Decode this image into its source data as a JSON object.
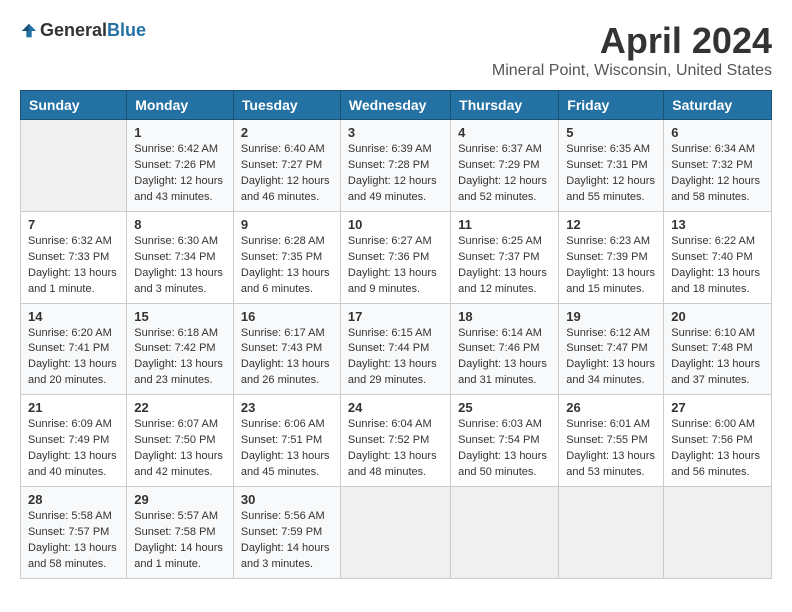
{
  "logo": {
    "general": "General",
    "blue": "Blue"
  },
  "title": "April 2024",
  "location": "Mineral Point, Wisconsin, United States",
  "days": [
    "Sunday",
    "Monday",
    "Tuesday",
    "Wednesday",
    "Thursday",
    "Friday",
    "Saturday"
  ],
  "weeks": [
    [
      {
        "day": "",
        "content": ""
      },
      {
        "day": "1",
        "content": "Sunrise: 6:42 AM\nSunset: 7:26 PM\nDaylight: 12 hours\nand 43 minutes."
      },
      {
        "day": "2",
        "content": "Sunrise: 6:40 AM\nSunset: 7:27 PM\nDaylight: 12 hours\nand 46 minutes."
      },
      {
        "day": "3",
        "content": "Sunrise: 6:39 AM\nSunset: 7:28 PM\nDaylight: 12 hours\nand 49 minutes."
      },
      {
        "day": "4",
        "content": "Sunrise: 6:37 AM\nSunset: 7:29 PM\nDaylight: 12 hours\nand 52 minutes."
      },
      {
        "day": "5",
        "content": "Sunrise: 6:35 AM\nSunset: 7:31 PM\nDaylight: 12 hours\nand 55 minutes."
      },
      {
        "day": "6",
        "content": "Sunrise: 6:34 AM\nSunset: 7:32 PM\nDaylight: 12 hours\nand 58 minutes."
      }
    ],
    [
      {
        "day": "7",
        "content": "Sunrise: 6:32 AM\nSunset: 7:33 PM\nDaylight: 13 hours\nand 1 minute."
      },
      {
        "day": "8",
        "content": "Sunrise: 6:30 AM\nSunset: 7:34 PM\nDaylight: 13 hours\nand 3 minutes."
      },
      {
        "day": "9",
        "content": "Sunrise: 6:28 AM\nSunset: 7:35 PM\nDaylight: 13 hours\nand 6 minutes."
      },
      {
        "day": "10",
        "content": "Sunrise: 6:27 AM\nSunset: 7:36 PM\nDaylight: 13 hours\nand 9 minutes."
      },
      {
        "day": "11",
        "content": "Sunrise: 6:25 AM\nSunset: 7:37 PM\nDaylight: 13 hours\nand 12 minutes."
      },
      {
        "day": "12",
        "content": "Sunrise: 6:23 AM\nSunset: 7:39 PM\nDaylight: 13 hours\nand 15 minutes."
      },
      {
        "day": "13",
        "content": "Sunrise: 6:22 AM\nSunset: 7:40 PM\nDaylight: 13 hours\nand 18 minutes."
      }
    ],
    [
      {
        "day": "14",
        "content": "Sunrise: 6:20 AM\nSunset: 7:41 PM\nDaylight: 13 hours\nand 20 minutes."
      },
      {
        "day": "15",
        "content": "Sunrise: 6:18 AM\nSunset: 7:42 PM\nDaylight: 13 hours\nand 23 minutes."
      },
      {
        "day": "16",
        "content": "Sunrise: 6:17 AM\nSunset: 7:43 PM\nDaylight: 13 hours\nand 26 minutes."
      },
      {
        "day": "17",
        "content": "Sunrise: 6:15 AM\nSunset: 7:44 PM\nDaylight: 13 hours\nand 29 minutes."
      },
      {
        "day": "18",
        "content": "Sunrise: 6:14 AM\nSunset: 7:46 PM\nDaylight: 13 hours\nand 31 minutes."
      },
      {
        "day": "19",
        "content": "Sunrise: 6:12 AM\nSunset: 7:47 PM\nDaylight: 13 hours\nand 34 minutes."
      },
      {
        "day": "20",
        "content": "Sunrise: 6:10 AM\nSunset: 7:48 PM\nDaylight: 13 hours\nand 37 minutes."
      }
    ],
    [
      {
        "day": "21",
        "content": "Sunrise: 6:09 AM\nSunset: 7:49 PM\nDaylight: 13 hours\nand 40 minutes."
      },
      {
        "day": "22",
        "content": "Sunrise: 6:07 AM\nSunset: 7:50 PM\nDaylight: 13 hours\nand 42 minutes."
      },
      {
        "day": "23",
        "content": "Sunrise: 6:06 AM\nSunset: 7:51 PM\nDaylight: 13 hours\nand 45 minutes."
      },
      {
        "day": "24",
        "content": "Sunrise: 6:04 AM\nSunset: 7:52 PM\nDaylight: 13 hours\nand 48 minutes."
      },
      {
        "day": "25",
        "content": "Sunrise: 6:03 AM\nSunset: 7:54 PM\nDaylight: 13 hours\nand 50 minutes."
      },
      {
        "day": "26",
        "content": "Sunrise: 6:01 AM\nSunset: 7:55 PM\nDaylight: 13 hours\nand 53 minutes."
      },
      {
        "day": "27",
        "content": "Sunrise: 6:00 AM\nSunset: 7:56 PM\nDaylight: 13 hours\nand 56 minutes."
      }
    ],
    [
      {
        "day": "28",
        "content": "Sunrise: 5:58 AM\nSunset: 7:57 PM\nDaylight: 13 hours\nand 58 minutes."
      },
      {
        "day": "29",
        "content": "Sunrise: 5:57 AM\nSunset: 7:58 PM\nDaylight: 14 hours\nand 1 minute."
      },
      {
        "day": "30",
        "content": "Sunrise: 5:56 AM\nSunset: 7:59 PM\nDaylight: 14 hours\nand 3 minutes."
      },
      {
        "day": "",
        "content": ""
      },
      {
        "day": "",
        "content": ""
      },
      {
        "day": "",
        "content": ""
      },
      {
        "day": "",
        "content": ""
      }
    ]
  ]
}
